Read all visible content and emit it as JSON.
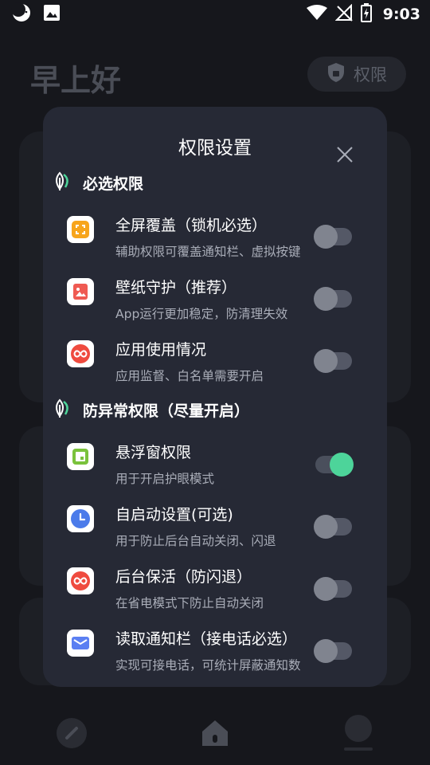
{
  "status_bar": {
    "time": "9:03",
    "left_icons": [
      "moon-face-icon",
      "image-icon"
    ],
    "right_icons": [
      "wifi-icon",
      "no-signal-icon",
      "battery-charging-icon"
    ]
  },
  "background": {
    "greeting": "早上好",
    "permission_chip": "权限",
    "nav_icons": [
      "pencil-icon",
      "home-icon",
      "profile-icon"
    ]
  },
  "dialog": {
    "title": "权限设置",
    "sections": [
      {
        "heading": "必选权限",
        "items": [
          {
            "title": "全屏覆盖（锁机必选）",
            "desc": "辅助权限可覆盖通知栏、虚拟按键",
            "enabled": false,
            "icon": "fullscreen-icon",
            "icon_color": "#f7a51c"
          },
          {
            "title": "壁纸守护（推荐）",
            "desc": "App运行更加稳定，防清理失效",
            "enabled": false,
            "icon": "wallpaper-icon",
            "icon_color": "#ef5a52"
          },
          {
            "title": "应用使用情况",
            "desc": "应用监督、白名单需要开启",
            "enabled": false,
            "icon": "infinity-icon",
            "icon_color": "#ef4b3f"
          }
        ]
      },
      {
        "heading": "防异常权限（尽量开启）",
        "items": [
          {
            "title": "悬浮窗权限",
            "desc": "用于开启护眼模式",
            "enabled": true,
            "icon": "floating-window-icon",
            "icon_color": "#7ac23c"
          },
          {
            "title": "自启动设置(可选)",
            "desc": "用于防止后台自动关闭、闪退",
            "enabled": false,
            "icon": "clock-icon",
            "icon_color": "#4b7bea"
          },
          {
            "title": "后台保活（防闪退）",
            "desc": "在省电模式下防止自动关闭",
            "enabled": false,
            "icon": "infinity-icon",
            "icon_color": "#ef4b3f"
          },
          {
            "title": "读取通知栏（接电话必选）",
            "desc": "实现可接电话，可统计屏蔽通知数",
            "enabled": false,
            "icon": "mail-icon",
            "icon_color": "#5b7ff2"
          }
        ]
      }
    ]
  },
  "colors": {
    "accent_green": "#4dd49a",
    "dialog_bg": "#262935",
    "page_bg": "#16171c"
  }
}
